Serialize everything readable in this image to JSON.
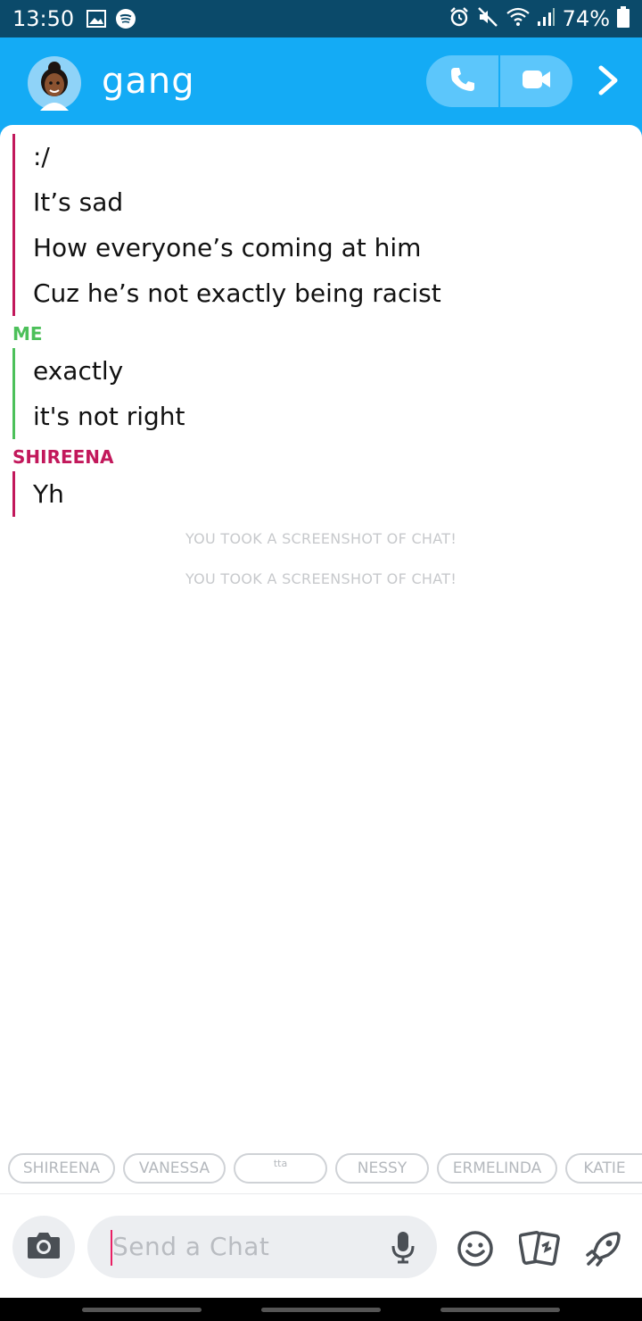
{
  "status_bar": {
    "time": "13:50",
    "battery": "74%",
    "icons": [
      "gallery-icon",
      "spotify-icon",
      "alarm-icon",
      "mute-icon",
      "wifi-icon",
      "signal-icon",
      "battery-icon"
    ]
  },
  "header": {
    "title": "gang",
    "icons": [
      "avatar",
      "phone-icon",
      "video-icon",
      "chevron-right-icon"
    ]
  },
  "chat": {
    "messages_block1": [
      ":/",
      "It’s sad",
      "How everyone’s coming at him",
      "Cuz he’s not exactly being racist"
    ],
    "sender_me": "ME",
    "messages_block2": [
      "exactly",
      "it's not right"
    ],
    "sender_shireena": "SHIREENA",
    "messages_block3": [
      "Yh"
    ],
    "notices": [
      "YOU TOOK A SCREENSHOT OF CHAT!",
      "YOU TOOK A SCREENSHOT OF CHAT!"
    ]
  },
  "mentions": [
    "SHIREENA",
    "VANESSA",
    "tta",
    "NESSY",
    "ERMELINDA",
    "KATIE"
  ],
  "input": {
    "placeholder": "Send a Chat",
    "icons": [
      "camera-icon",
      "mic-icon",
      "emoji-icon",
      "cards-icon",
      "rocket-icon"
    ]
  },
  "colors": {
    "header": "#14abf5",
    "status_bar": "#0b4a6a",
    "friend_accent": "#c2185b",
    "me_accent": "#4cc05a"
  }
}
